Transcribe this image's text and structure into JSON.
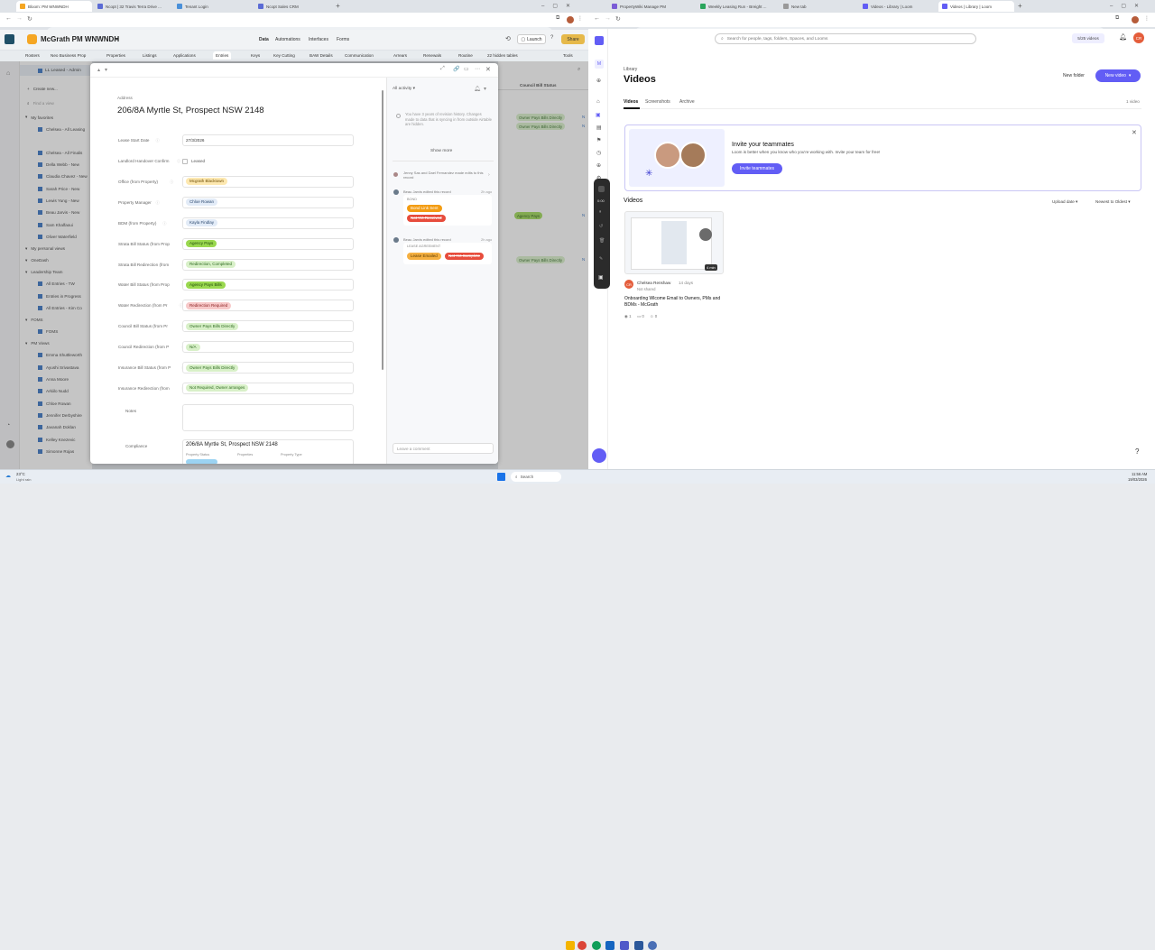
{
  "left_browser": {
    "tabs": [
      {
        "label": "Bloom: PM WNWNDH",
        "active": true,
        "color": "#f5a623"
      },
      {
        "label": "Ncopt | 32 Travis Terra Drive ...",
        "active": false,
        "color": "#5b6bd5"
      },
      {
        "label": "Tenant Login",
        "active": false,
        "color": "#4a90d9"
      },
      {
        "label": "Ncopt Sales CRM",
        "active": false,
        "color": "#5b6bd5"
      }
    ],
    "url": "airtable.com/appwMSOptkB0iUcWQ/tbl4cuNdI3qrk8KvIC/viwxRgoGEmmm0s3b7?r=gig2ZC5bAGAyNo7b&cols=hide"
  },
  "right_browser": {
    "tabs": [
      {
        "label": "PropertyWiki Manage PM",
        "active": false,
        "color": "#7b5cd6"
      },
      {
        "label": "Weekly Leasing Run - Breight ...",
        "active": false,
        "color": "#2aa55c"
      },
      {
        "label": "New tab",
        "active": false,
        "color": "#999999"
      },
      {
        "label": "Videos - Library | Loom",
        "active": false,
        "color": "#625df5"
      },
      {
        "label": "Videos | Library | Loom",
        "active": true,
        "color": "#625df5"
      }
    ],
    "url": "loom.com/looms/videos"
  },
  "airtable": {
    "base_name": "McGrath PM WNWNDH",
    "header_tabs": [
      "Data",
      "Automations",
      "Interfaces",
      "Forms"
    ],
    "launch_label": "Launch",
    "share_label": "Share",
    "table_tabs": [
      "Rosters",
      "Neo Business Prop",
      "Properties",
      "Listings",
      "Applications",
      "Entries",
      "Keys",
      "Key Cutting",
      "BAW Details",
      "Communication",
      "Arrears",
      "Renewals",
      "Routine",
      "22 hidden tables",
      "Tools"
    ],
    "sidebar_top": [
      "Create new...",
      "Find a view"
    ],
    "sections": [
      {
        "title": "My favorites",
        "items": [
          "Chelsea - All Leasing",
          "LL Leased - Admin Sta",
          "Chelsea - All Finalis",
          "Della Webb - New",
          "Claudia Chavez - New",
          "Sarah Price - New",
          "Lewis Yung - New",
          "Beau Jarvis - New",
          "Sam Khalfaoui",
          "Oliver Waterfield"
        ]
      },
      {
        "title": "My personal views",
        "items": []
      },
      {
        "title": "OneDash",
        "items": []
      },
      {
        "title": "Leadership Team",
        "items": [
          "All Entries - TW",
          "Entries in Progress",
          "All Entries - Kim Co"
        ]
      },
      {
        "title": "FOMS",
        "items": [
          "FOMS"
        ]
      },
      {
        "title": "PM Views",
        "items": [
          "Emma Shuttleworth",
          "Ayushi Srivastava",
          "Anna Moore",
          "Arkiilo Nudd",
          "Chloe Rowan",
          "Jennifer Derbyshire",
          "Javanah Doklan",
          "Kelley Knezevic",
          "Simonne Rojas"
        ]
      }
    ],
    "current_view": "LL Leased - Admin",
    "grid": {
      "header": "Council Bill Status",
      "cells": [
        {
          "label": "Owner Pays Bills Directly",
          "bg": "#d8f0c8",
          "fg": "#2d6a1f"
        },
        {
          "label": "Owner Pays Bills Directly",
          "bg": "#d8f0c8",
          "fg": "#2d6a1f"
        },
        {
          "label": "Agency Pays",
          "bg": "#9ad84f",
          "fg": "#1f4a0a"
        },
        {
          "label": "Owner Pays Bills Directly",
          "bg": "#d8f0c8",
          "fg": "#2d6a1f"
        }
      ]
    }
  },
  "record": {
    "eyebrow": "Address",
    "title": "206/8A Myrtle St, Prospect NSW 2148",
    "fields": [
      {
        "label": "Lease Start Date",
        "value": "27/3/2026",
        "type": "text"
      },
      {
        "label": "Landlord Handover Confirm",
        "value": "Leased",
        "type": "check"
      },
      {
        "label": "Office (from Property)",
        "value": "Mcgrath Blacktown",
        "type": "pill",
        "bg": "#fde8b0",
        "fg": "#6b4a00"
      },
      {
        "label": "Property Manager",
        "value": "Chloe Rowan",
        "type": "pill",
        "bg": "#e2ebf7",
        "fg": "#2d4a70"
      },
      {
        "label": "BDM (from Property)",
        "value": "Kayla Findlay",
        "type": "pill",
        "bg": "#e2ebf7",
        "fg": "#2d4a70"
      },
      {
        "label": "Strata Bill Status (from Prop",
        "value": "Agency Pays",
        "type": "pill",
        "bg": "#9ad84f",
        "fg": "#1f4a0a"
      },
      {
        "label": "Strata Bill Redirection (from",
        "value": "Redirection, Completed",
        "type": "pill",
        "bg": "#d8f0c8",
        "fg": "#2d6a1f"
      },
      {
        "label": "Water Bill Status (from Prop",
        "value": "Agency Pays Bills",
        "type": "pill",
        "bg": "#9ad84f",
        "fg": "#1f4a0a"
      },
      {
        "label": "Water Redirection (from Pr",
        "value": "Redirection Required",
        "type": "pill",
        "bg": "#f7c9c9",
        "fg": "#8a1f1f"
      },
      {
        "label": "Council Bill Status (from Pr",
        "value": "Owner Pays Bills Directly",
        "type": "pill",
        "bg": "#d8f0c8",
        "fg": "#2d6a1f"
      },
      {
        "label": "Council Redirection (from P",
        "value": "N/A",
        "type": "pill",
        "bg": "#d8f0c8",
        "fg": "#2d6a1f"
      },
      {
        "label": "Insurance Bill Status (from P",
        "value": "Owner Pays Bills Directly",
        "type": "pill",
        "bg": "#d8f0c8",
        "fg": "#2d6a1f"
      },
      {
        "label": "Insurance Redirection (from",
        "value": "Not Required, Owner arranges",
        "type": "pill",
        "bg": "#d8f0c8",
        "fg": "#2d6a1f"
      }
    ],
    "notes_label": "Notes",
    "compliance_label": "Compliance",
    "linked_title": "206/8A Myrtle St, Prospect NSW 2148",
    "linked_cols": [
      "Property Status",
      "Properties",
      "Property Type"
    ],
    "activity": {
      "filter": "All activity",
      "history_note": "You have 3 years of revision history. Changes made to data that is syncing in from outside Airtable are hidden.",
      "show_more": "Show more",
      "event1": "Jenny Sas and Dael Fernandez made edits to this record",
      "event2": "Beau Jarvis edited this record",
      "event2_time": "2h ago",
      "event2_field": "BOND",
      "event2_pills": [
        {
          "label": "Bond Link Sent",
          "bg": "#f39c12",
          "fg": "#ffffff"
        },
        {
          "label": "Not Yet Received",
          "bg": "#e74c3c",
          "fg": "#ffffff"
        }
      ],
      "event3": "Beau Jarvis edited this record",
      "event3_time": "2h ago",
      "event3_field": "LEASE AGREEMENT",
      "event3_pills": [
        {
          "label": "Lease Emailed",
          "bg": "#f5b041",
          "fg": "#5a3a00"
        },
        {
          "label": "Not Yet Complete",
          "bg": "#e74c3c",
          "fg": "#ffffff"
        }
      ],
      "comment_placeholder": "Leave a comment"
    }
  },
  "loom": {
    "search_placeholder": "Search for people, tags, folders, Spaces, and Looms",
    "videos_count_badge": "5/25 videos",
    "avatar_initials": "CR",
    "library_label": "Library",
    "page_title": "Videos",
    "new_folder": "New folder",
    "new_video": "New video",
    "tabs": [
      "Videos",
      "Screenshots",
      "Archive"
    ],
    "video_count": "1 video",
    "invite_title": "Invite your teammates",
    "invite_body": "Loom is better when you know who you're working with. Invite your team for free!",
    "invite_button": "Invite teammates",
    "section_title": "Videos",
    "sort_upload": "Upload date",
    "sort_order": "Newest to Oldest",
    "video": {
      "author": "Chelsea Renshaw",
      "age": "14 days",
      "shared": "Not shared",
      "duration": "4 min",
      "title": "Onboarding Wlcome Email to Owners, PMs and BDMs - McGrath",
      "views": "1",
      "comments": "0",
      "reactions": "0"
    },
    "recorder_time": "0:00",
    "help_label": "?"
  },
  "taskbar": {
    "weather": "23°C",
    "weather_sub": "Light rain",
    "search": "Search",
    "time": "11:56 AM",
    "date": "19/03/2026"
  },
  "colors": {
    "airtable_header": "#1f4f67",
    "loom_accent": "#625df5",
    "airtable_sidebar": "#ffffff"
  }
}
